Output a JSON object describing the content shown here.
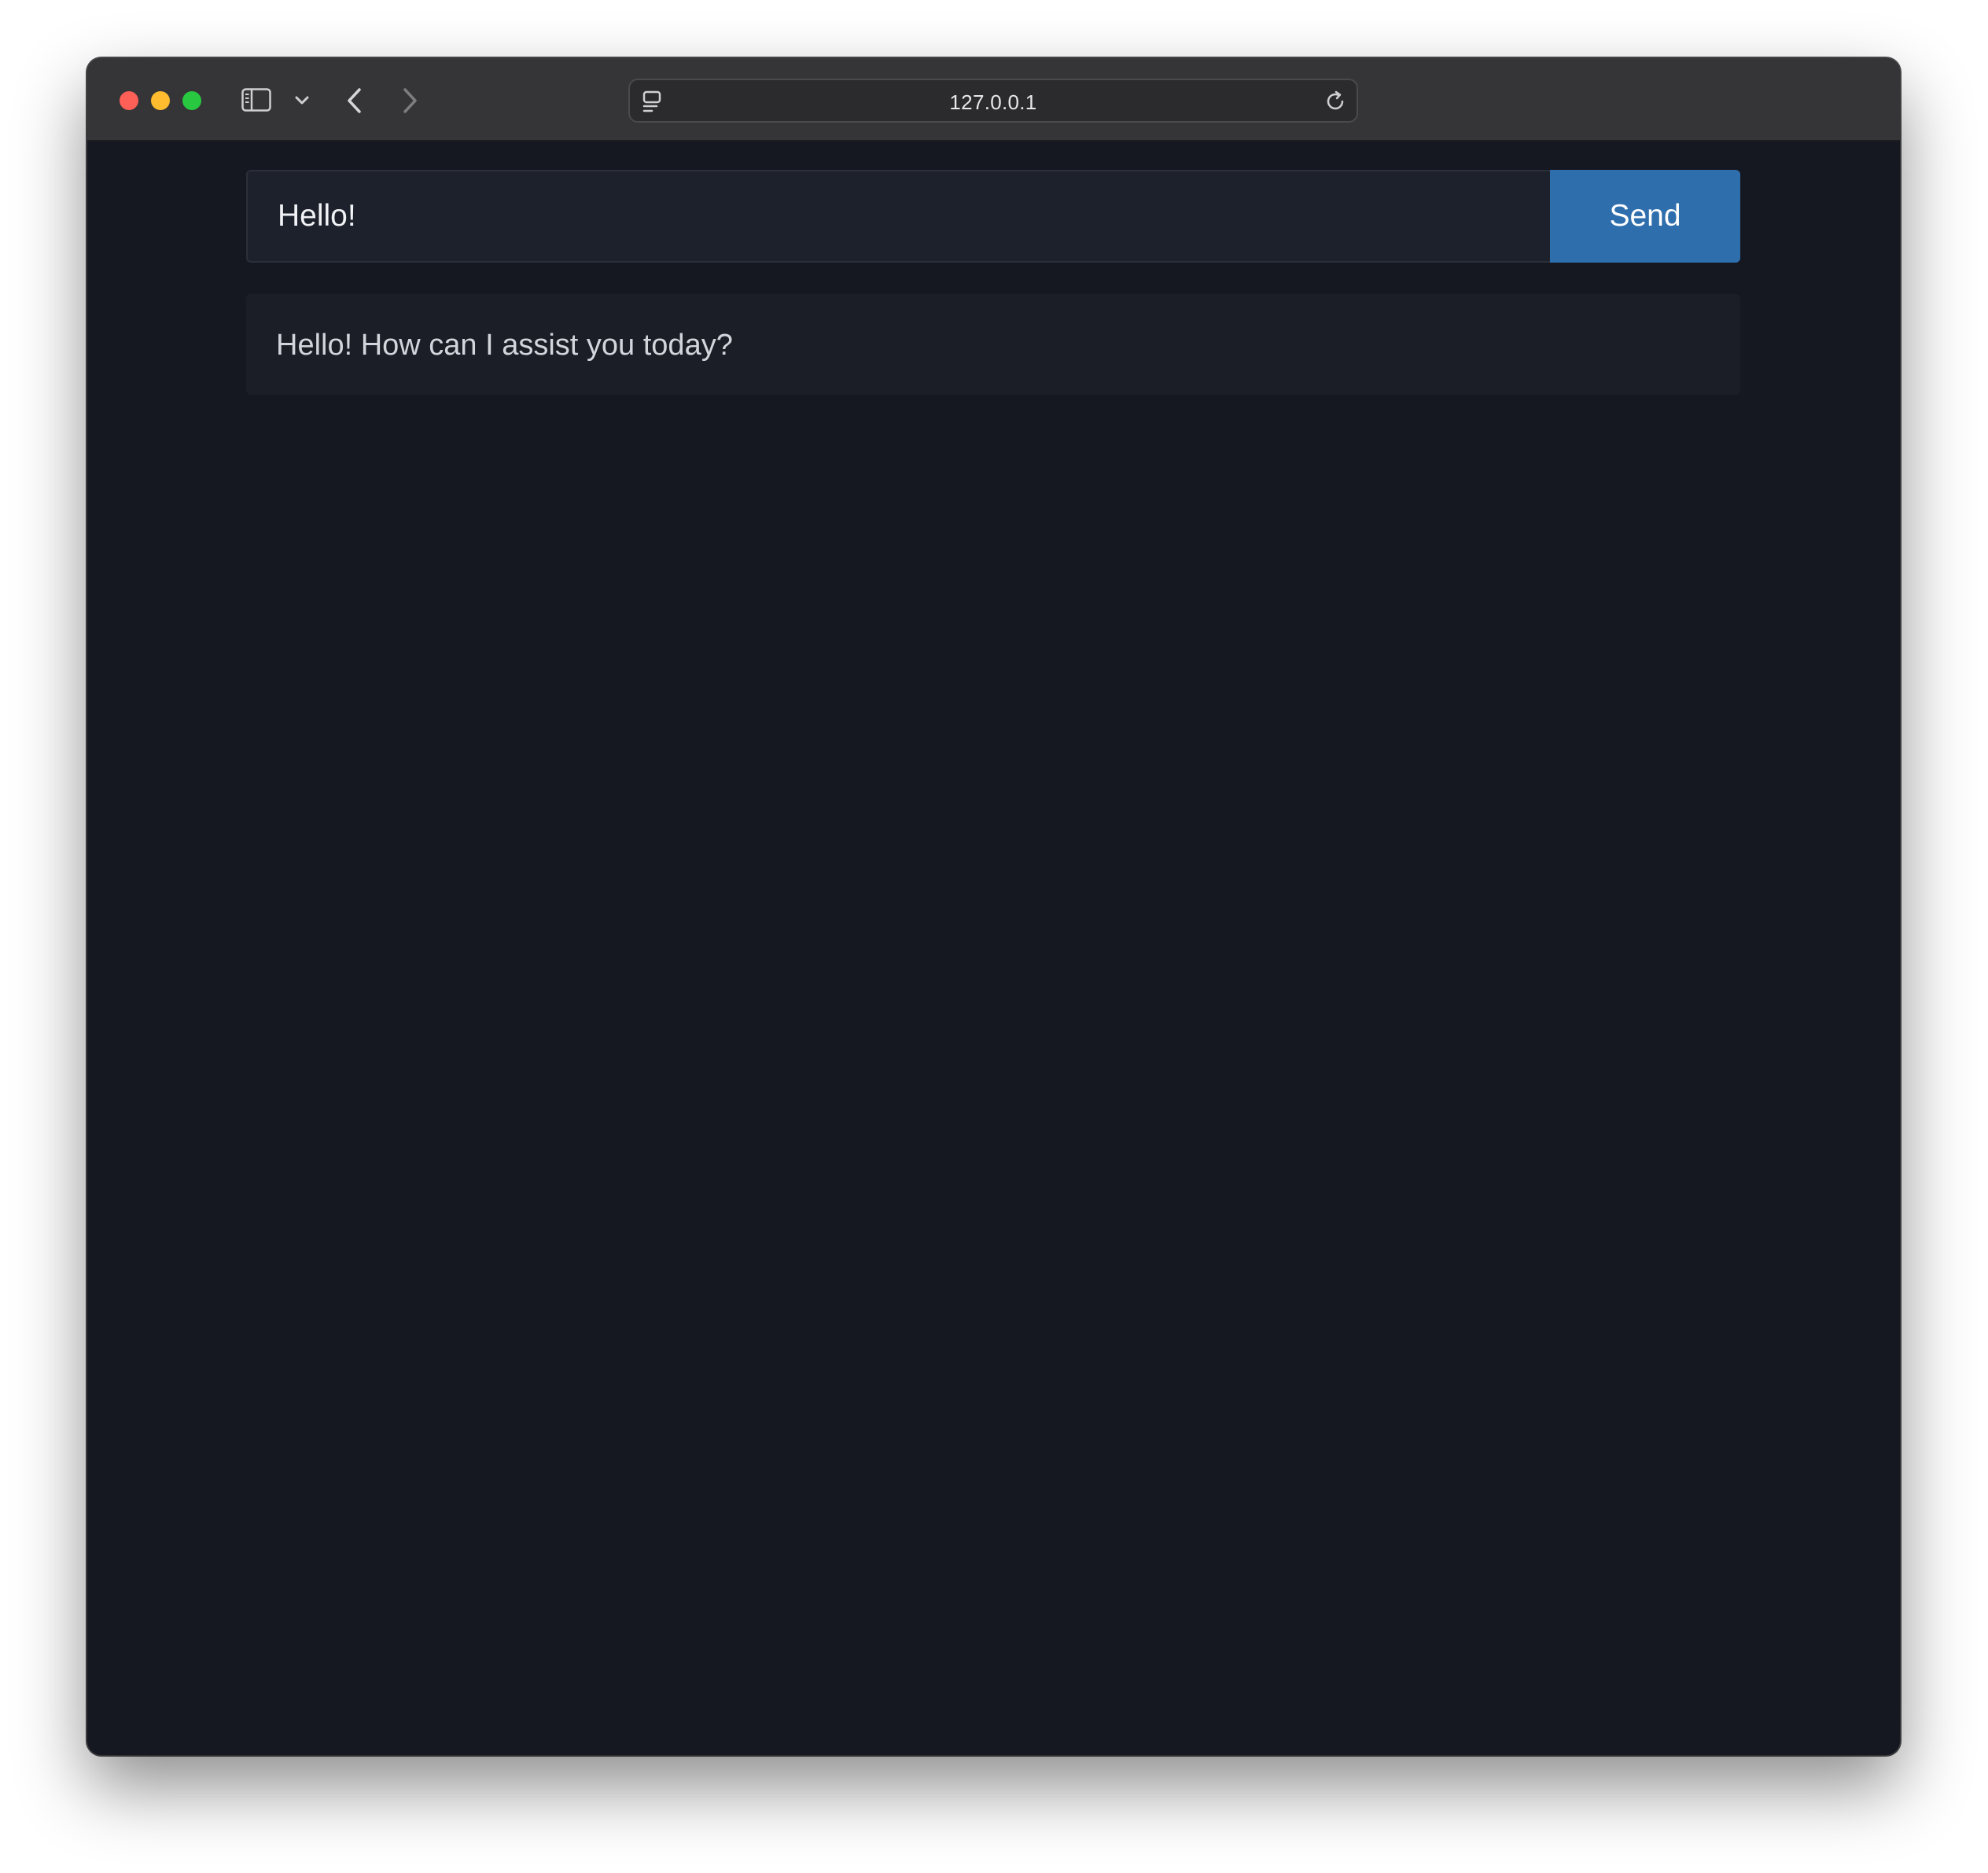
{
  "browser": {
    "url": "127.0.0.1",
    "icons": [
      "sidebar-icon",
      "chevron-down-icon",
      "back-arrow-icon",
      "forward-arrow-icon",
      "site-settings-icon",
      "reload-icon"
    ]
  },
  "chat": {
    "input_value": "Hello!",
    "send_label": "Send",
    "response_text": "Hello! How can I assist you today?"
  },
  "colors": {
    "page_background": "#151820",
    "send_button": "#2f6ead",
    "input_background": "#1d212b",
    "response_background": "#1b1e26"
  }
}
